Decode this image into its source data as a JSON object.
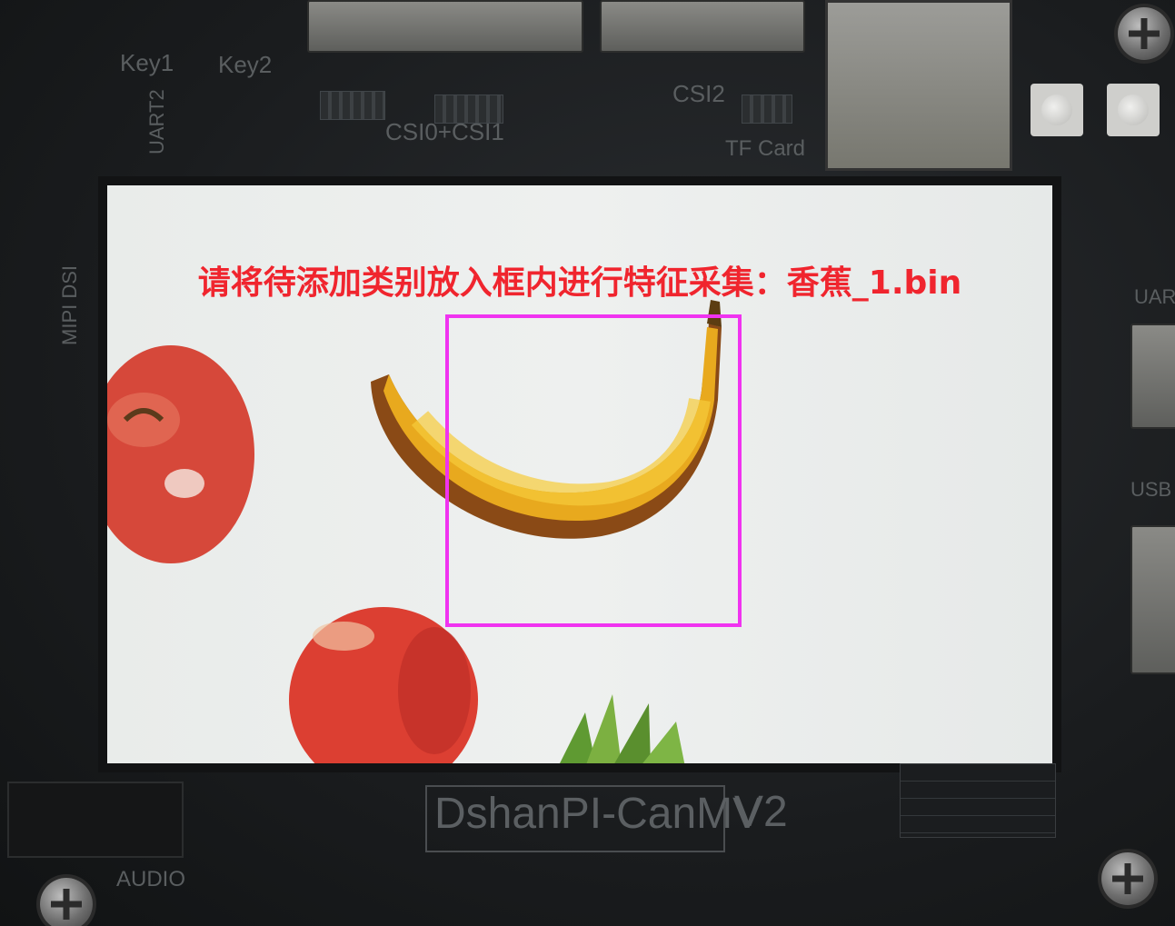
{
  "screen": {
    "prompt": "请将待添加类别放入框内进行特征采集：香蕉_1.bin"
  },
  "board_labels": {
    "key1": "Key1",
    "key2": "Key2",
    "uart2": "UART2",
    "csi0_csi1": "CSI0+CSI1",
    "csi2": "CSI2",
    "tf_card": "TF Card",
    "mipi_dsi": "MIPI DSI",
    "audio": "AUDIO",
    "brand": "DshanPI-CanMV",
    "version": "V2",
    "uart": "UART",
    "usb": "USB"
  },
  "colors": {
    "prompt_text": "#f0252e",
    "capture_box": "#f033f0",
    "screen_bg": "#eceeed"
  }
}
